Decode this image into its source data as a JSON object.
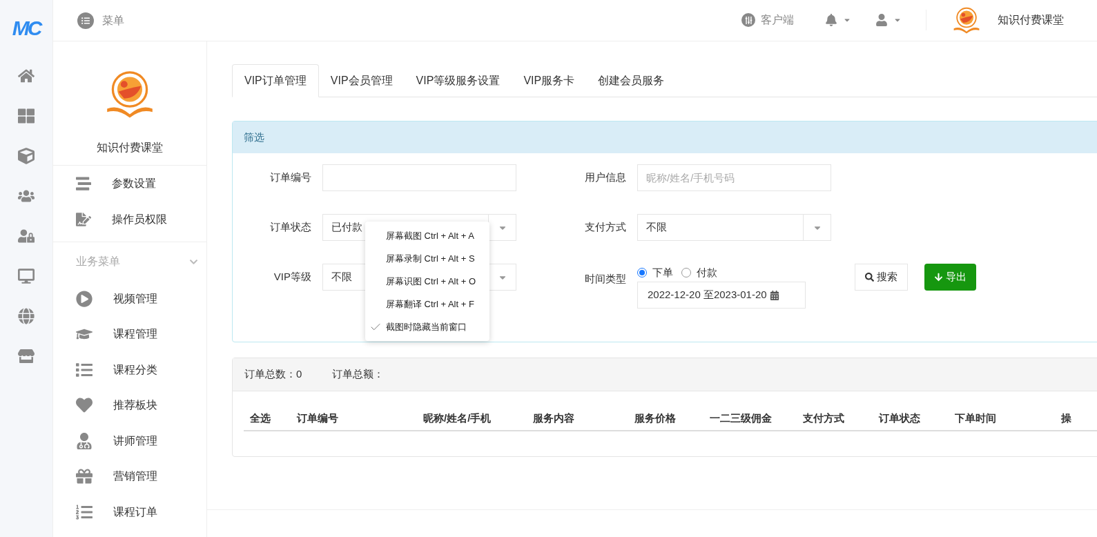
{
  "rail": {
    "logo": "MC"
  },
  "topbar": {
    "menu_label": "菜单",
    "client_label": "客户端",
    "brand": "知识付费课堂"
  },
  "sidebar": {
    "brand": "知识付费课堂",
    "items": [
      "参数设置",
      "操作员权限"
    ],
    "section": {
      "title": "业务菜单",
      "expanded": true,
      "items": [
        "视频管理",
        "课程管理",
        "课程分类",
        "推荐板块",
        "讲师管理",
        "营销管理",
        "课程订单"
      ]
    }
  },
  "tabs": [
    {
      "label": "VIP订单管理",
      "selected": true
    },
    {
      "label": "VIP会员管理",
      "selected": false
    },
    {
      "label": "VIP等级服务设置",
      "selected": false
    },
    {
      "label": "VIP服务卡",
      "selected": false
    },
    {
      "label": "创建会员服务",
      "selected": false
    }
  ],
  "filter": {
    "title": "筛选",
    "fields": [
      {
        "kind": "text",
        "label": "订单编号"
      },
      {
        "kind": "text",
        "label": "用户信息",
        "placeholder": "昵称/姓名/手机号码"
      },
      {
        "kind": "select",
        "label": "订单状态",
        "value": "已付款"
      },
      {
        "kind": "select",
        "label": "支付方式",
        "value": "不限"
      },
      {
        "kind": "select",
        "label": "VIP等级",
        "value": "不限"
      },
      {
        "kind": "time",
        "label": "时间类型",
        "options": [
          {
            "label": "下单",
            "selected": true
          },
          {
            "label": "付款",
            "selected": false
          }
        ],
        "value": "2022-12-20 至2023-01-20"
      }
    ],
    "buttons": [
      {
        "kind": "search",
        "label": "搜索"
      },
      {
        "kind": "export",
        "label": "导出"
      }
    ]
  },
  "context_menu": {
    "items": [
      {
        "label": "屏幕截图 Ctrl + Alt + A",
        "checked": false
      },
      {
        "label": "屏幕录制 Ctrl + Alt + S",
        "checked": false
      },
      {
        "label": "屏幕识图 Ctrl + Alt + O",
        "checked": false
      },
      {
        "label": "屏幕翻译 Ctrl + Alt + F",
        "checked": false
      },
      {
        "label": "截图时隐藏当前窗口",
        "checked": true
      }
    ]
  },
  "summary": {
    "count_label": "订单总数：",
    "count": "0",
    "amount_label": "订单总额："
  },
  "table": {
    "columns": [
      "全选",
      "订单编号",
      "昵称/姓名/手机",
      "服务内容",
      "服务价格",
      "一二三级佣金",
      "支付方式",
      "订单状态",
      "下单时间",
      "操"
    ]
  }
}
